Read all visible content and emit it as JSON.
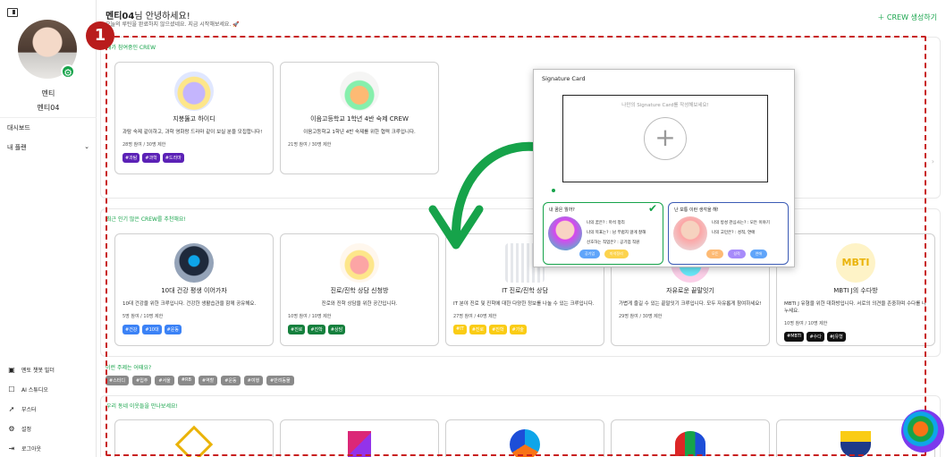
{
  "sidebar": {
    "user_name": "멘티",
    "user_id": "멘티04",
    "nav_dashboard": "대시보드",
    "nav_plan": "내 플랜",
    "bottom_menu": [
      {
        "label": "멘토 챗봇 빌더",
        "icon": "robot-icon"
      },
      {
        "label": "AI 스튜디오",
        "icon": "square-icon"
      },
      {
        "label": "부스터",
        "icon": "rocket-icon"
      },
      {
        "label": "설정",
        "icon": "gear-icon"
      },
      {
        "label": "로그아웃",
        "icon": "logout-icon"
      }
    ]
  },
  "callout_number": "1",
  "header": {
    "name": "멘티04",
    "greeting_suffix": "님 안녕하세요!",
    "sub": "오늘의 루틴을 완료하지 않으셨네요. 지금 시작해보세요.",
    "create_button": "CREW 생성하기"
  },
  "sections": {
    "my_crew": {
      "title": "내가 참여중인 CREW",
      "cards": [
        {
          "title": "지붕뚫고 하이디",
          "desc": "과탐 숙제 같이하고, 과학 영화랑 드라마 같이 보실 분을 모집합니다!",
          "meta": "28명 참여 / 30명 제한",
          "tags": [
            "#과탐",
            "#과학",
            "#드라마"
          ]
        },
        {
          "title": "이음고등학교 1학년 4반 숙제 CREW",
          "desc": "이음고등학교 1학년 4반 숙제를 위한 협력 크루입니다.",
          "meta": "21명 참여 / 30명 제한",
          "tags": []
        }
      ]
    },
    "popular": {
      "title": "최근 인기 많은 CREW를 추천해요!",
      "cards": [
        {
          "title": "10대 건강 평생 이어가자",
          "desc": "10대 건강을 위한 크루입니다. 건강한 생활습관을 함께 공유해요.",
          "meta": "5명 참여 / 10명 제한",
          "tags": [
            "#건강",
            "#10대",
            "#운동"
          ]
        },
        {
          "title": "진로/진학 상담 신청방",
          "desc": "진로와 진학 상담을 위한 공간입니다.",
          "meta": "10명 참여 / 10명 제한",
          "tags": [
            "#진로",
            "#진학",
            "#상담"
          ]
        },
        {
          "title": "IT 진로/진학 상담",
          "desc": "IT 분야 진로 및 진학에 대한 다양한 정보를 나눌 수 있는 크루입니다.",
          "meta": "27명 참여 / 40명 제한",
          "tags": [
            "#IT",
            "#진로",
            "#진학",
            "#기술"
          ]
        },
        {
          "title": "자유로운 끝말잇기",
          "desc": "가볍게 즐길 수 있는 끝말잇기 크루입니다. 모두 자유롭게 참여하세요!",
          "meta": "29명 참여 / 30명 제한",
          "tags": []
        },
        {
          "title": "MBTI J의 수다방",
          "desc": "MBTI J 유형을 위한 대화방입니다. 서로의 의견을 존중하며 수다를 나누세요.",
          "meta": "10명 참여 / 10명 제한",
          "tags": [
            "#MBTI",
            "#수다",
            "#J유형"
          ]
        }
      ]
    },
    "keywords": {
      "title": "이런 주제는 어때요?",
      "items": [
        "#스터디",
        "#입주",
        "#서울",
        "#RB",
        "#역할",
        "#운동",
        "#여행",
        "#반려동물"
      ]
    },
    "neighbors": {
      "title": "우리 동네 이웃들을 만나보세요!"
    }
  },
  "signature": {
    "title": "Signature Card",
    "hint": "나만의 Signature Card를 작성해보세요!",
    "options": [
      {
        "title": "내 꿈은 뭘까?",
        "lines": [
          "나의 꿈은? : 마석 정리",
          "나의 목표는? : 남 부럽지 않게 잘해",
          "선호하는 직업은? : 공기업 직원"
        ],
        "buttons": [
          "공기업",
          "마석정리"
        ]
      },
      {
        "title": "난 보통 이런 생각을 해!",
        "lines": [
          "나의 방성 관심사는? : 모든 이야기",
          "나의 고민은? : 성적, 연애"
        ],
        "buttons": [
          "모든",
          "성적",
          "연애"
        ]
      }
    ]
  },
  "colors": {
    "accent": "#16a34a",
    "callout": "#b91c1c",
    "dashed": "#c81e1e",
    "tag_purple": "#5b21b6",
    "tag_blue": "#3b82f6",
    "tag_green": "#15803d",
    "tag_yellow": "#facc15",
    "tag_black": "#111111"
  }
}
